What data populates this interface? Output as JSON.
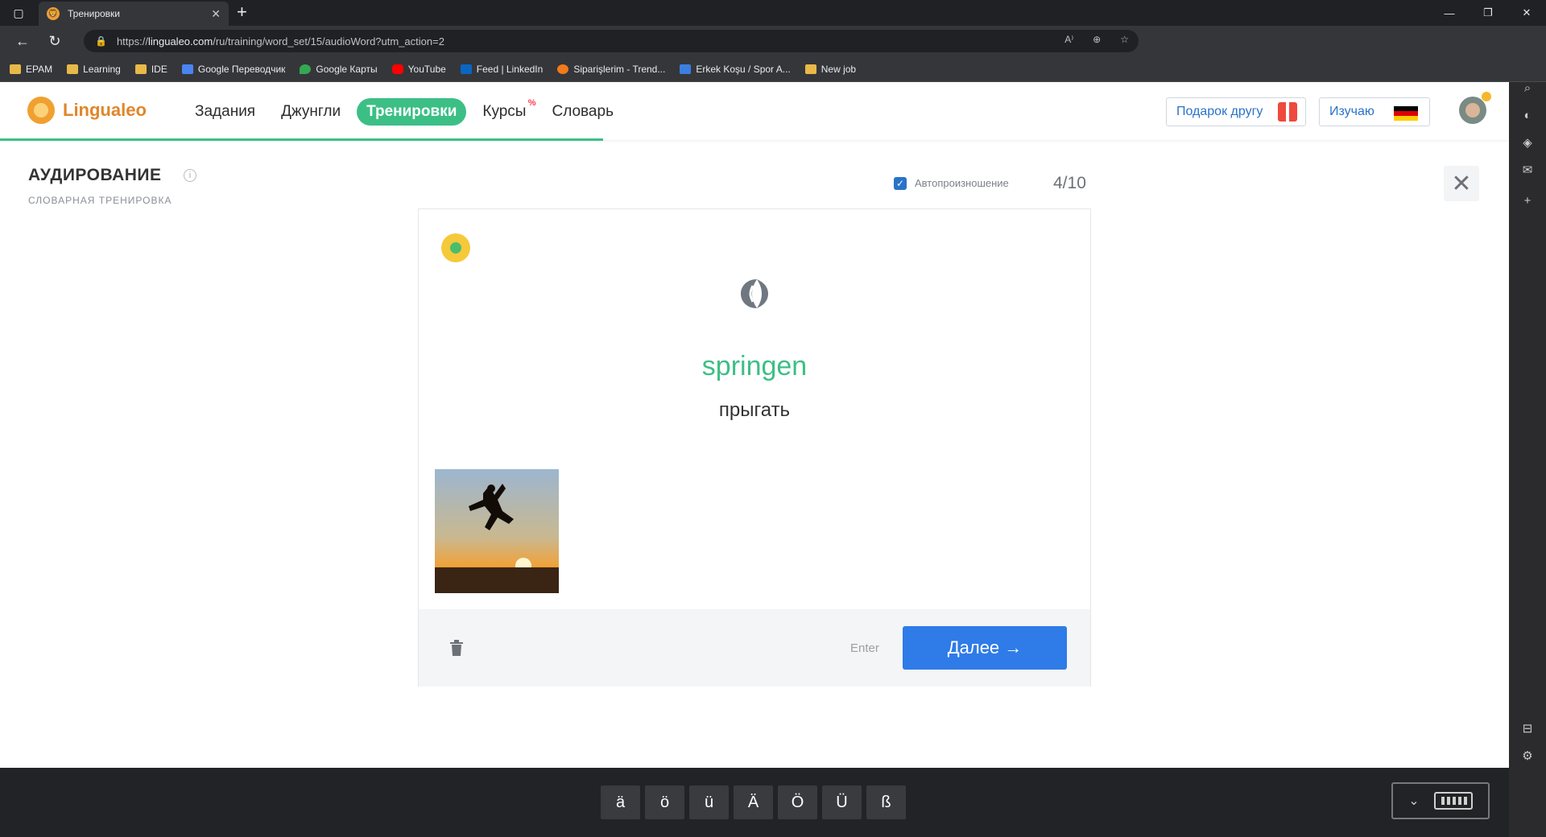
{
  "browser": {
    "tab_title": "Тренировки",
    "url_prefix": "https://",
    "url_host": "lingualeo.com",
    "url_path": "/ru/training/word_set/15/audioWord?utm_action=2",
    "bookmarks": [
      {
        "label": "EPAM",
        "icon": "folder-icon"
      },
      {
        "label": "Learning",
        "icon": "folder-icon"
      },
      {
        "label": "IDE",
        "icon": "folder-icon"
      },
      {
        "label": "Google Переводчик",
        "icon": "translate-icon"
      },
      {
        "label": "Google Карты",
        "icon": "maps-icon"
      },
      {
        "label": "YouTube",
        "icon": "youtube-icon"
      },
      {
        "label": "Feed | LinkedIn",
        "icon": "linkedin-icon"
      },
      {
        "label": "Siparişlerim - Trend...",
        "icon": "trendyol-icon"
      },
      {
        "label": "Erkek Koşu / Spor A...",
        "icon": "decathlon-icon"
      },
      {
        "label": "New job",
        "icon": "folder-icon"
      }
    ]
  },
  "header": {
    "logo": "Lingualeo",
    "nav": [
      "Задания",
      "Джунгли",
      "Тренировки",
      "Курсы",
      "Словарь"
    ],
    "nav_sup": "%",
    "gift_button": "Подарок другу",
    "learn_button": "Изучаю",
    "colors": {
      "accent": "#3cbf85",
      "brand": "#e0862a",
      "link": "#2a73c9"
    }
  },
  "training": {
    "title": "АУДИРОВАНИЕ",
    "subtitle": "СЛОВАРНАЯ ТРЕНИРОВКА",
    "auto_pronounce_label": "Автопроизношение",
    "auto_pronounce_checked": true,
    "counter": "4/10",
    "word": "springen",
    "translation": "прыгать",
    "enter_hint": "Enter",
    "next_button": "Далее →",
    "progress_fraction": 0.4
  },
  "keyboard": {
    "chars": [
      "ä",
      "ö",
      "ü",
      "Ä",
      "Ö",
      "Ü",
      "ß"
    ],
    "toggle_icon": "keyboard-icon"
  }
}
